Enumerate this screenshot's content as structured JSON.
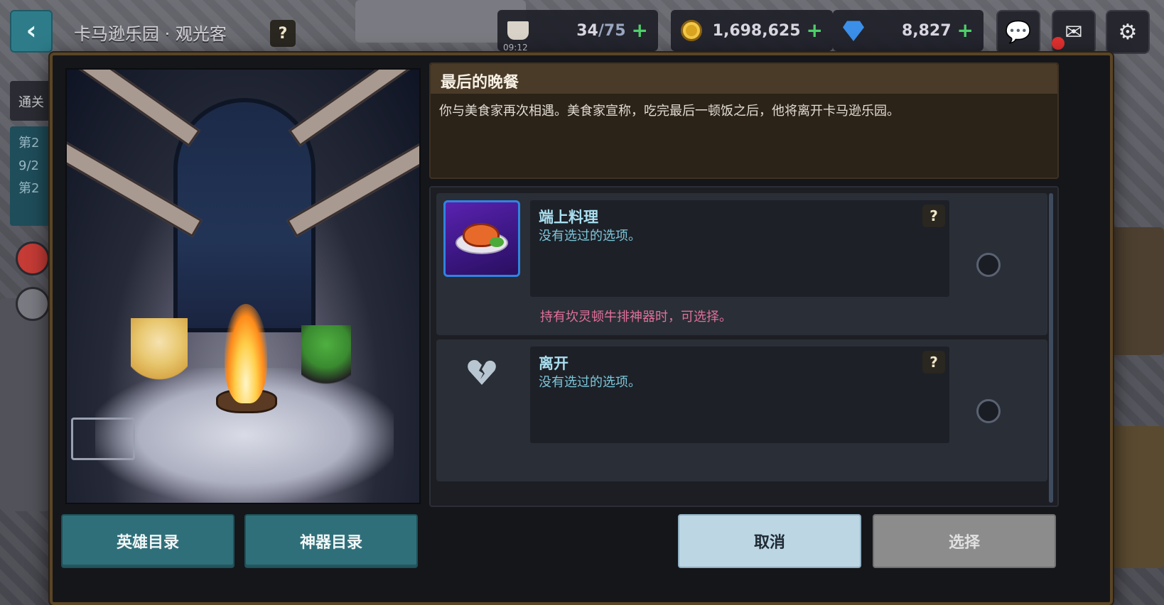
{
  "hud": {
    "location": "卡马逊乐园 · 观光客",
    "location_help": "?",
    "stamina": {
      "current": "34",
      "max": "/75",
      "timer": "09:12"
    },
    "gold": "1,698,625",
    "gems": "8,827",
    "plus": "+"
  },
  "side": {
    "tab1": "通关",
    "tab2_line1": "第2",
    "tab2_line2": "9/2",
    "tab2_line3": "第2"
  },
  "event": {
    "title": "最后的晚餐",
    "description": "你与美食家再次相遇。美食家宣称，吃完最后一顿饭之后，他将离开卡马逊乐园。"
  },
  "options": [
    {
      "name": "端上料理",
      "status": "没有选过的选项。",
      "requirement": "持有坎灵顿牛排神器时，可选择。",
      "help": "?",
      "icon": "steak-dish-icon"
    },
    {
      "name": "离开",
      "status": "没有选过的选项。",
      "help": "?",
      "icon": "broken-heart-icon"
    }
  ],
  "buttons": {
    "hero_list": "英雄目录",
    "artifact_list": "神器目录",
    "cancel": "取消",
    "select": "选择"
  },
  "colors": {
    "accent_teal": "#2f6f7a",
    "cancel_bg": "#bcd6e4",
    "select_disabled": "#8c8c8c",
    "option_name": "#a9dff0",
    "requirement_text": "#e0709a",
    "gold_plus": "#4ecf6a"
  }
}
